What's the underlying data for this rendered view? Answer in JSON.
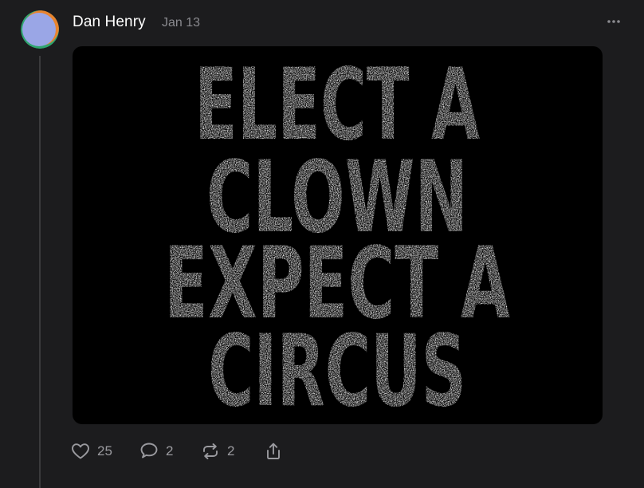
{
  "post": {
    "author": "Dan Henry",
    "timestamp": "Jan 13",
    "image_text": [
      "ELECT A",
      "CLOWN",
      "EXPECT A",
      "CIRCUS"
    ],
    "actions": {
      "like_count": "25",
      "reply_count": "2",
      "repost_count": "2"
    }
  },
  "icons": {
    "more": "ellipsis-icon",
    "like": "heart-icon",
    "reply": "speech-bubble-icon",
    "repost": "repost-arrows-icon",
    "share": "share-upload-icon"
  },
  "colors": {
    "background": "#1c1c1e",
    "text_primary": "#ffffff",
    "text_secondary": "#8a8a8f",
    "thread_line": "#3a3a3c",
    "image_background": "#000000"
  }
}
